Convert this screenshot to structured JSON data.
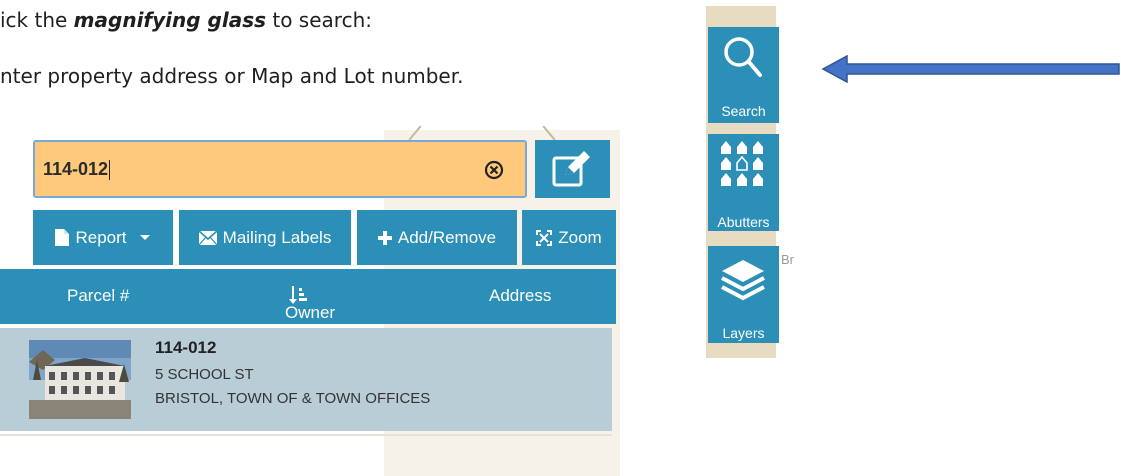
{
  "instructions": {
    "line1_prefix": "ick the ",
    "line1_emphasis": "magnifying glass",
    "line1_suffix": " to search:",
    "line2": "nter property address or Map and Lot number."
  },
  "search": {
    "value": "114-012"
  },
  "toolbar": {
    "report_label": "Report",
    "mailing_labels_label": "Mailing Labels",
    "add_remove_label": "Add/Remove",
    "zoom_label": "Zoom"
  },
  "columns": {
    "parcel": "Parcel #",
    "owner": "Owner",
    "address": "Address"
  },
  "result": {
    "parcel": "114-012",
    "address": "5 SCHOOL ST",
    "owner": "BRISTOL, TOWN OF & TOWN OFFICES"
  },
  "side_toolbar": {
    "search_label": "Search",
    "abutters_label": "Abutters",
    "layers_label": "Layers"
  },
  "map": {
    "fragment_text": "Br"
  },
  "colors": {
    "accent": "#2b8fb7",
    "input_bg": "#fec97a",
    "result_bg": "#b9cdd7",
    "arrow_fill": "#4472c4"
  }
}
